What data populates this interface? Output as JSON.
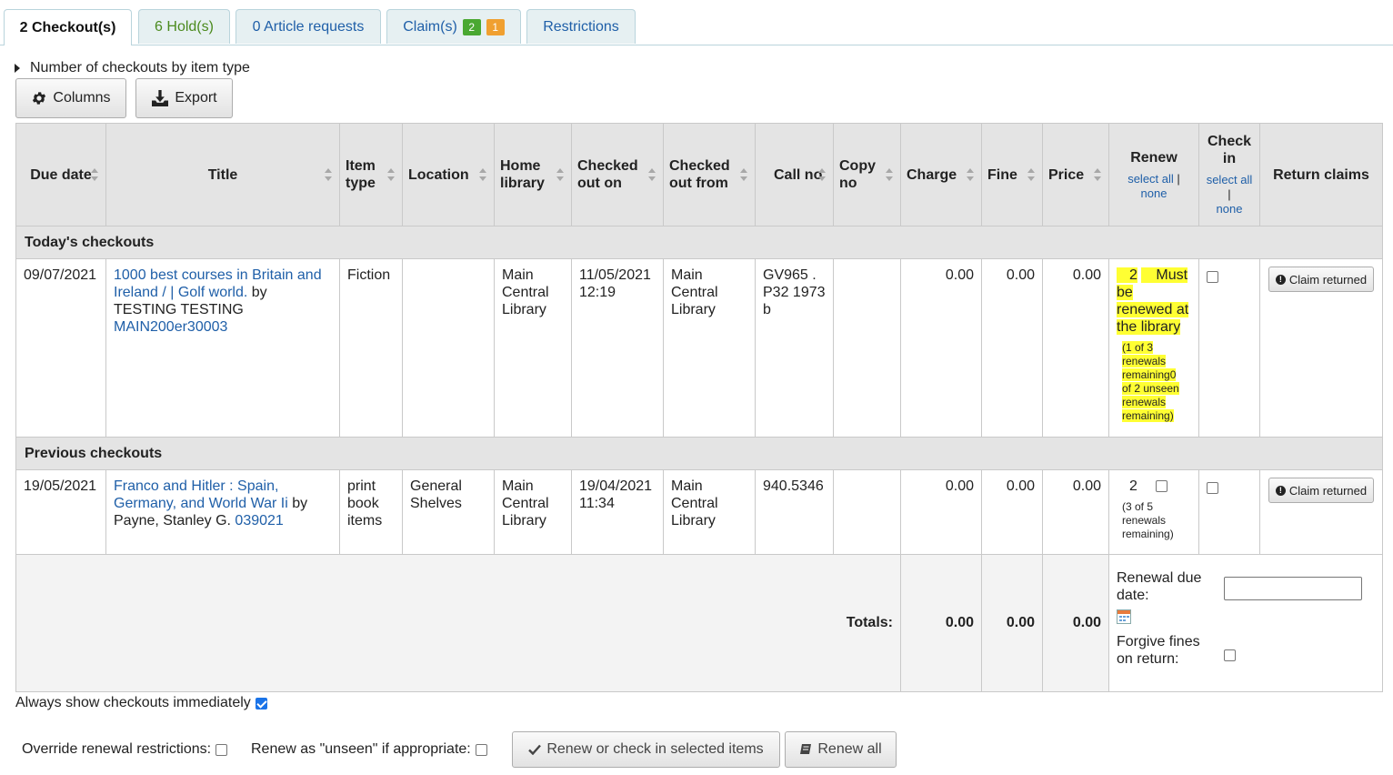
{
  "tabs": [
    {
      "label": "2 Checkout(s)"
    },
    {
      "label": "6 Hold(s)"
    },
    {
      "label": "0 Article requests"
    },
    {
      "label": "Claim(s)",
      "badge1": "2",
      "badge2": "1"
    },
    {
      "label": "Restrictions"
    }
  ],
  "toggle_label": "Number of checkouts by item type",
  "toolbar": {
    "columns": "Columns",
    "export": "Export"
  },
  "table": {
    "headers": {
      "due_date": "Due date",
      "title": "Title",
      "item_type": "Item type",
      "location": "Location",
      "home_library": "Home library",
      "checked_out_on": "Checked out on",
      "checked_out_from": "Checked out from",
      "call_no": "Call no",
      "copy_no": "Copy no",
      "charge": "Charge",
      "fine": "Fine",
      "price": "Price",
      "renew": "Renew",
      "check_in": "Check in",
      "return_claims": "Return claims"
    },
    "select_all": "select all",
    "select_sep": "|",
    "select_none": "none",
    "groups": [
      {
        "label": "Today's checkouts",
        "row": {
          "due": "09/07/2021",
          "title": "1000 best courses in Britain and Ireland / | Golf world.",
          "by": "by",
          "author": "TESTING TESTING",
          "barcode": "MAIN200er30003",
          "item_type": "Fiction",
          "location": "",
          "home_library": "Main Central Library",
          "checked_out_on": "11/05/2021 12:19",
          "checked_out_from": "Main Central Library",
          "call_no": "GV965 .P32 1973b",
          "copy_no": "",
          "charge": "0.00",
          "fine": "0.00",
          "price": "0.00",
          "renew_count": "2",
          "renew_note": "Must be renewed at the library",
          "renew_remaining": "(1 of 3 renewals remaining0 of 2 unseen renewals remaining)",
          "claim": "Claim returned"
        }
      },
      {
        "label": "Previous checkouts",
        "row": {
          "due": "19/05/2021",
          "title": "Franco and Hitler : Spain, Germany, and World War Ii",
          "by": "by",
          "author": "Payne, Stanley G.",
          "barcode": "039021",
          "item_type": "print book items",
          "location": "General Shelves",
          "home_library": "Main Central Library",
          "checked_out_on": "19/04/2021 11:34",
          "checked_out_from": "Main Central Library",
          "call_no": "940.5346",
          "copy_no": "",
          "charge": "0.00",
          "fine": "0.00",
          "price": "0.00",
          "renew_count": "2",
          "renew_remaining": "(3 of 5 renewals remaining)",
          "claim": "Claim returned"
        }
      }
    ],
    "totals": {
      "label": "Totals:",
      "charge": "0.00",
      "fine": "0.00",
      "price": "0.00"
    },
    "renewal_due_label": "Renewal due date:",
    "forgive_label": "Forgive fines on return:"
  },
  "always_show_label": "Always show checkouts immediately",
  "always_show_checked": true,
  "override_label": "Override renewal restrictions:",
  "unseen_label": "Renew as \"unseen\" if appropriate:",
  "renew_checkin_button": "Renew or check in selected items",
  "renew_all_button": "Renew all"
}
